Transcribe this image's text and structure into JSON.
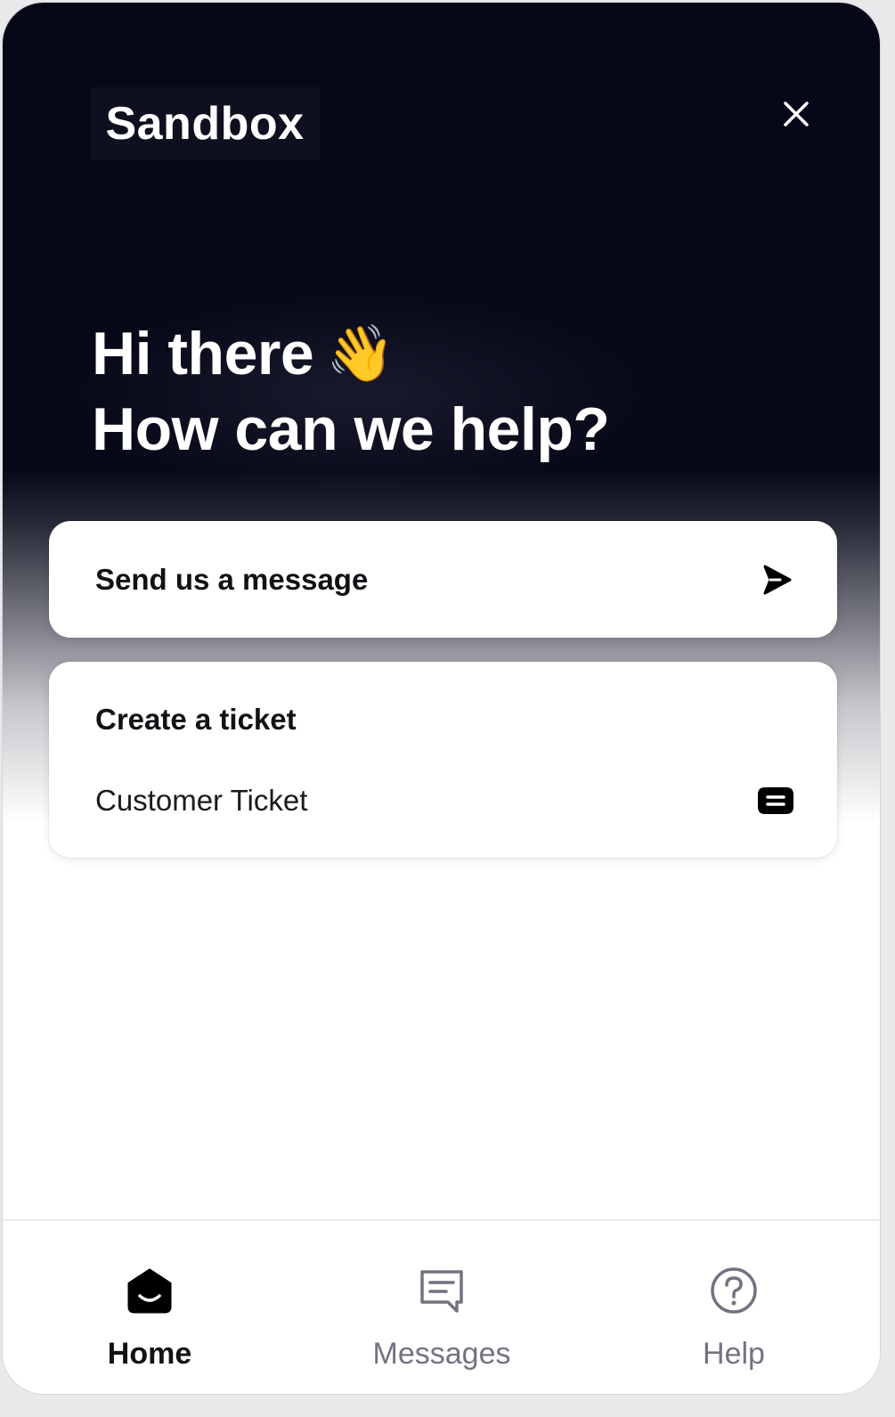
{
  "header": {
    "brand": "Sandbox",
    "close_icon": "close-icon"
  },
  "hero": {
    "line1": "Hi there",
    "wave": "👋",
    "line2": "How can we help?"
  },
  "actions": {
    "send_message": {
      "label": "Send us a message",
      "icon": "send-arrow-icon"
    },
    "create_ticket": {
      "title": "Create a ticket",
      "items": [
        {
          "label": "Customer Ticket",
          "icon": "ticket-icon"
        }
      ]
    }
  },
  "nav": {
    "items": [
      {
        "label": "Home",
        "icon": "home-icon",
        "active": true
      },
      {
        "label": "Messages",
        "icon": "messages-icon",
        "active": false
      },
      {
        "label": "Help",
        "icon": "help-icon",
        "active": false
      }
    ]
  },
  "colors": {
    "hero_dark": "#060818",
    "text_primary": "#111116",
    "nav_inactive": "#737380",
    "card_bg": "#ffffff"
  }
}
